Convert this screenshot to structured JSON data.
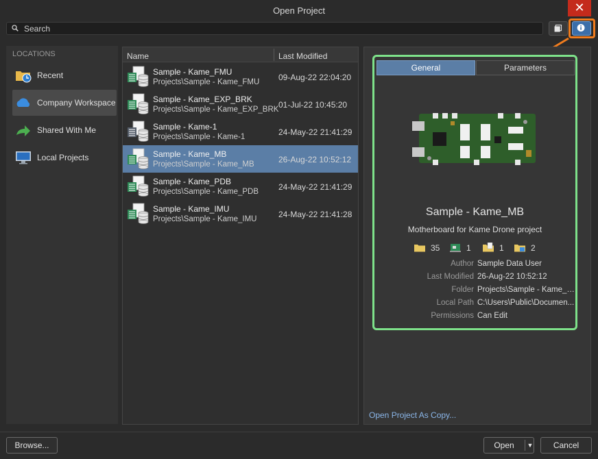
{
  "window": {
    "title": "Open Project",
    "close_label": "✕"
  },
  "search": {
    "placeholder": "Search"
  },
  "locations": {
    "header": "LOCATIONS",
    "items": [
      {
        "label": "Recent",
        "icon": "recent-folder-icon"
      },
      {
        "label": "Company Workspace",
        "icon": "cloud-icon",
        "active": true
      },
      {
        "label": "Shared With Me",
        "icon": "share-arrow-icon"
      },
      {
        "label": "Local Projects",
        "icon": "monitor-icon"
      }
    ]
  },
  "file_list": {
    "columns": [
      "Name",
      "Last Modified"
    ],
    "rows": [
      {
        "name": "Sample - Kame_FMU",
        "path": "Projects\\Sample - Kame_FMU",
        "modified": "09-Aug-22 22:04:20"
      },
      {
        "name": "Sample - Kame_EXP_BRK",
        "path": "Projects\\Sample - Kame_EXP_BRK",
        "modified": "01-Jul-22 10:45:20"
      },
      {
        "name": "Sample - Kame-1",
        "path": "Projects\\Sample - Kame-1",
        "modified": "24-May-22 21:41:29"
      },
      {
        "name": "Sample - Kame_MB",
        "path": "Projects\\Sample - Kame_MB",
        "modified": "26-Aug-22 10:52:12",
        "selected": true
      },
      {
        "name": "Sample - Kame_PDB",
        "path": "Projects\\Sample - Kame_PDB",
        "modified": "24-May-22 21:41:29"
      },
      {
        "name": "Sample - Kame_IMU",
        "path": "Projects\\Sample - Kame_IMU",
        "modified": "24-May-22 21:41:28"
      }
    ]
  },
  "details": {
    "tabs": [
      "General",
      "Parameters"
    ],
    "title": "Sample - Kame_MB",
    "description": "Motherboard for Kame Drone project",
    "counts": [
      "35",
      "1",
      "1",
      "2"
    ],
    "properties": [
      {
        "key": "Author",
        "value": "Sample Data User"
      },
      {
        "key": "Last Modified",
        "value": "26-Aug-22 10:52:12"
      },
      {
        "key": "Folder",
        "value": "Projects\\Sample - Kame_MB"
      },
      {
        "key": "Local Path",
        "value": "C:\\Users\\Public\\Documen..."
      },
      {
        "key": "Permissions",
        "value": "Can Edit"
      }
    ],
    "open_as_copy": "Open Project As Copy..."
  },
  "footer": {
    "browse": "Browse...",
    "open": "Open",
    "cancel": "Cancel"
  },
  "colors": {
    "selection": "#5b7ea6",
    "highlight_green": "#7ee28a",
    "highlight_orange": "#f07c1e",
    "link": "#8bb7ea"
  }
}
